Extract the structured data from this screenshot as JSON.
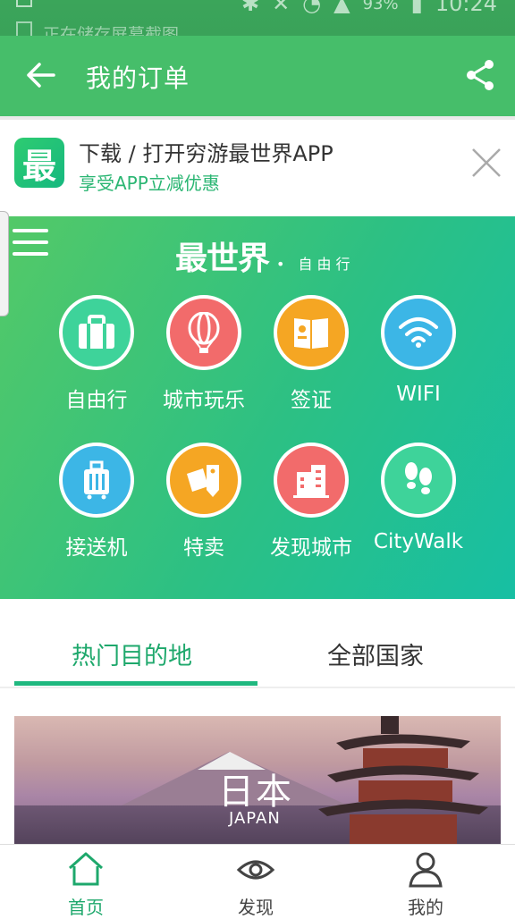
{
  "status_bar": {
    "notification_text": "正在储存屏幕截图",
    "battery": "93%",
    "time": "10:24"
  },
  "appbar": {
    "title": "我的订单"
  },
  "banner": {
    "logo_text": "最",
    "title": "下载 / 打开穷游最世界APP",
    "subtitle": "享受APP立减优惠"
  },
  "hero": {
    "brand": "最世界",
    "brand_sub": "• 自由行",
    "items": [
      {
        "label": "自由行",
        "icon": "suitcase-icon",
        "color": "#3ed39a"
      },
      {
        "label": "城市玩乐",
        "icon": "balloon-icon",
        "color": "#f26b6b"
      },
      {
        "label": "签证",
        "icon": "passport-icon",
        "color": "#f5a623"
      },
      {
        "label": "WIFI",
        "icon": "wifi-icon",
        "color": "#3cb6e6"
      },
      {
        "label": "接送机",
        "icon": "luggage-icon",
        "color": "#3cb6e6"
      },
      {
        "label": "特卖",
        "icon": "tag-icon",
        "color": "#f5a623"
      },
      {
        "label": "发现城市",
        "icon": "building-icon",
        "color": "#f26b6b"
      },
      {
        "label": "CityWalk",
        "icon": "footprints-icon",
        "color": "#3ed39a"
      }
    ]
  },
  "destinations": {
    "tab_hot": "热门目的地",
    "tab_all": "全部国家",
    "card": {
      "name": "日本",
      "name_en": "JAPAN"
    }
  },
  "bottom_nav": {
    "items": [
      {
        "label": "首页",
        "icon": "home-icon",
        "active": true
      },
      {
        "label": "发现",
        "icon": "eye-icon",
        "active": false
      },
      {
        "label": "我的",
        "icon": "user-icon",
        "active": false
      }
    ]
  },
  "colors": {
    "brand_green": "#46be6a",
    "accent": "#1ea86c"
  }
}
